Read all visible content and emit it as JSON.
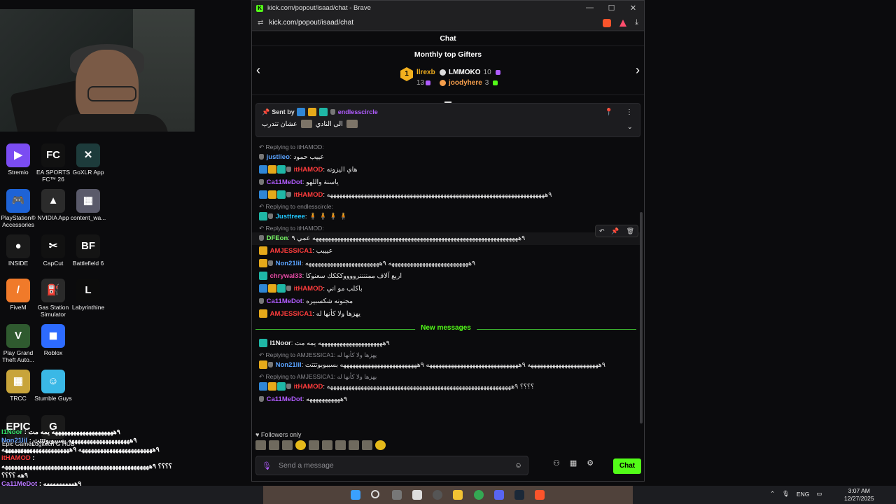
{
  "desktop": {
    "icons": [
      {
        "label": "Stremio",
        "color": "#7b4cf2",
        "glyph": "▶"
      },
      {
        "label": "EA SPORTS FC™ 26",
        "color": "#111111",
        "glyph": "FC"
      },
      {
        "label": "GoXLR App",
        "color": "#1d3b3b",
        "glyph": "✕"
      },
      {
        "label": "PlayStation® Accessories",
        "color": "#1e63d6",
        "glyph": "🎮"
      },
      {
        "label": "NVIDIA App",
        "color": "#2b2b2b",
        "glyph": "▲"
      },
      {
        "label": "content_wa...",
        "color": "#5a5a6a",
        "glyph": "▦"
      },
      {
        "label": "INSIDE",
        "color": "#1a1a1a",
        "glyph": "●"
      },
      {
        "label": "CapCut",
        "color": "#111111",
        "glyph": "✂"
      },
      {
        "label": "Battlefield 6",
        "color": "#141414",
        "glyph": "BF"
      },
      {
        "label": "FiveM",
        "color": "#f07a2a",
        "glyph": "/"
      },
      {
        "label": "Gas Station Simulator",
        "color": "#2a2a2a",
        "glyph": "⛽"
      },
      {
        "label": "Labyrinthine",
        "color": "#0c0c0c",
        "glyph": "L"
      },
      {
        "label": "Play Grand Theft Auto...",
        "color": "#2f5a2f",
        "glyph": "V"
      },
      {
        "label": "Roblox",
        "color": "#2d6bff",
        "glyph": "◼"
      },
      {
        "label": "TRCC",
        "color": "#c8a43a",
        "glyph": "▦"
      },
      {
        "label": "Stumble Guys",
        "color": "#3ab8e6",
        "glyph": "☺"
      },
      {
        "label": "Epic Games Launcher",
        "color": "#1a1a1a",
        "glyph": "EPIC"
      },
      {
        "label": "Logitech G HUB",
        "color": "#1a1a1a",
        "glyph": "G"
      }
    ]
  },
  "overlay_chat": [
    {
      "user": "l1Noor",
      "text": ": ٩ههههههههههههههههههههه يمه مت"
    },
    {
      "user": "Non21lil",
      "text": ": ٩ههههههههههههههههههههه بسببوبوتتتت"
    },
    {
      "user": "",
      "text": "٩ههههههههههههههههههههههههه ٩ههههههههههههههههههههههه"
    },
    {
      "user": "itHAMOD",
      "text": ":"
    },
    {
      "user": "",
      "text": "؟؟؟؟ ٩ههههههههههههههههههههههههههههههههههههههههههههههههه"
    },
    {
      "user": "",
      "text": "٩هه ؟؟؟؟"
    },
    {
      "user": "Ca11MeDot",
      "text": ": ٩ههههههههههه"
    }
  ],
  "browser": {
    "title": "kick.com/popout/isaad/chat - Brave",
    "url": "kick.com/popout/isaad/chat",
    "min": "—",
    "max": "☐",
    "close": "✕"
  },
  "chat": {
    "header": "Chat",
    "gifters": {
      "title": "Monthly top Gifters",
      "rank": "1",
      "first": {
        "name": "llrexb",
        "count": "13"
      },
      "second": {
        "name": "LMMOKO",
        "count": "10"
      },
      "third": {
        "name": "joodyhere",
        "count": "3"
      }
    },
    "pinned": {
      "sent_by": "Sent by",
      "user": "endlesscircle",
      "text_a": "الى النادي",
      "text_b": "عشان تتدرب"
    },
    "messages": [
      {
        "reply": "Replying to itHAMOD:",
        "user": "justlieo",
        "color": "c-blue",
        "text": "عييب حمود",
        "badges": [
          "grey"
        ]
      },
      {
        "user": "itHAMOD",
        "color": "c-red",
        "text": "هاي اليزونه",
        "badges": [
          "blue",
          "gold",
          "teal",
          "grey"
        ]
      },
      {
        "user": "Ca11MeDot",
        "color": "c-purple",
        "text": "ياسنة واللهو",
        "badges": [
          "grey"
        ]
      },
      {
        "user": "itHAMOD",
        "color": "c-red",
        "text": "٩هههههههههههههههههههههههههههههههههههههههههههههههههههههههههههههههههههههههه",
        "badges": [
          "blue",
          "gold",
          "teal",
          "grey"
        ]
      },
      {
        "reply": "Replying to endlesscircle:",
        "user": "Justtreee",
        "color": "c-cyan",
        "text": "🧍 🧍 🧍 🧍",
        "badges": [
          "teal",
          "grey"
        ]
      },
      {
        "reply": "Replying to itHAMOD:",
        "user": "DFEon",
        "color": "c-lime",
        "text": "٩هههههههههههههههههههههههههههههههههههههههههههههههههههههههههههههههههههه عمي ٩",
        "badges": [
          "grey"
        ],
        "hover": true
      },
      {
        "user": "AMJESSICA1",
        "color": "c-red",
        "text": "عييبب",
        "badges": [
          "gold"
        ]
      },
      {
        "user": "Non21lil",
        "color": "c-blue",
        "text": "٩ههههههههههههههههههههههههههه ٩ههههههههههههههههههههههههه",
        "badges": [
          "gold",
          "grey"
        ]
      },
      {
        "user": "chrywal33",
        "color": "c-pink2",
        "text": "اربع آلاف ممننننرووووكككك سعنوكا",
        "badges": [
          "teal"
        ]
      },
      {
        "user": "itHAMOD",
        "color": "c-red",
        "text": "باكلب مو اني",
        "badges": [
          "blue",
          "gold",
          "teal",
          "grey"
        ]
      },
      {
        "user": "Ca11MeDot",
        "color": "c-purple",
        "text": "مجنونه شكسبيره",
        "badges": [
          "grey"
        ]
      },
      {
        "user": "AMJESSICA1",
        "color": "c-red",
        "text": "يهزها ولا كأنها له",
        "badges": [
          "gold"
        ]
      }
    ],
    "new_messages_label": "New messages",
    "new_messages": [
      {
        "user": "l1Noor",
        "color": "c-white",
        "text": "٩هههههههههههههههههههههه يمه مت",
        "badges": [
          "teal"
        ]
      },
      {
        "reply": "Replying to AMJESSICA1:",
        "reply_text": "يهزها ولا كأنها له",
        "user": "Non21lil",
        "color": "c-blue",
        "text": "٩هههههههههههههههههههههههه ٩ههههههههههههههههههههههههههههههه ٩هههههههههههههههههههههههههه بسببوبوتتتت",
        "badges": [
          "gold",
          "grey"
        ]
      },
      {
        "reply": "Replying to AMJESSICA1:",
        "reply_text": "يهزها ولا كأنها له",
        "user": "itHAMOD",
        "color": "c-red",
        "text": "؟؟؟؟ ٩ههههههههههههههههههههههههههههههههههههههههههههههههههههههههههههه",
        "badges": [
          "blue",
          "gold",
          "teal",
          "grey"
        ]
      },
      {
        "user": "Ca11MeDot",
        "color": "c-purple",
        "text": "٩هههههههههههه",
        "badges": [
          "grey"
        ]
      }
    ],
    "followers_only": "Followers only",
    "composer_placeholder": "Send a message",
    "chat_button": "Chat"
  },
  "taskbar": {
    "lang": "ENG",
    "time": "3:07 AM",
    "date": "12/27/2025"
  }
}
